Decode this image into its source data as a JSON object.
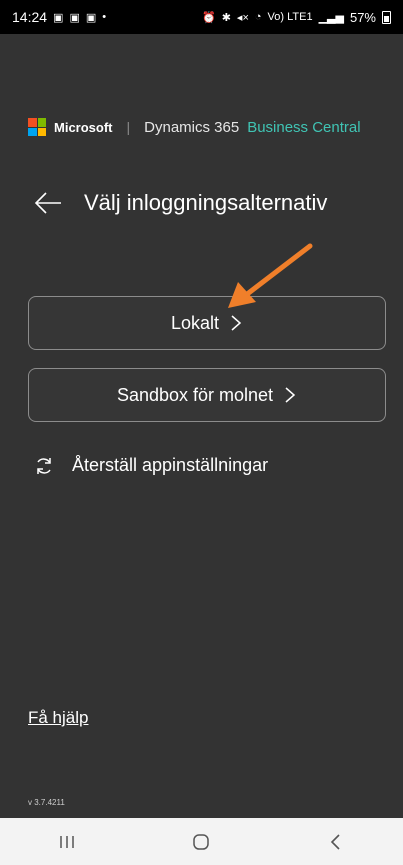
{
  "status_bar": {
    "time": "14:24",
    "left_icons": [
      "teams-icon",
      "teams-icon",
      "teams-icon",
      "dot"
    ],
    "right_icons_text": "⏰ ✱ 🔇 ",
    "network_text": "Vo) LTE1",
    "battery_percent": "57%",
    "battery_level": 0.57
  },
  "header": {
    "microsoft_label": "Microsoft",
    "separator": "|",
    "product_name": "Dynamics 365",
    "product_suffix": "Business Central",
    "accent_color": "#40c4b4"
  },
  "page": {
    "title": "Välj inloggningsalternativ"
  },
  "options": [
    {
      "label": "Lokalt"
    },
    {
      "label": "Sandbox för molnet"
    }
  ],
  "reset": {
    "label": "Återställ appinställningar"
  },
  "help": {
    "label": "Få hjälp"
  },
  "version": "v 3.7.4211",
  "colors": {
    "background": "#333333",
    "annotation_arrow": "#f07f2a"
  }
}
